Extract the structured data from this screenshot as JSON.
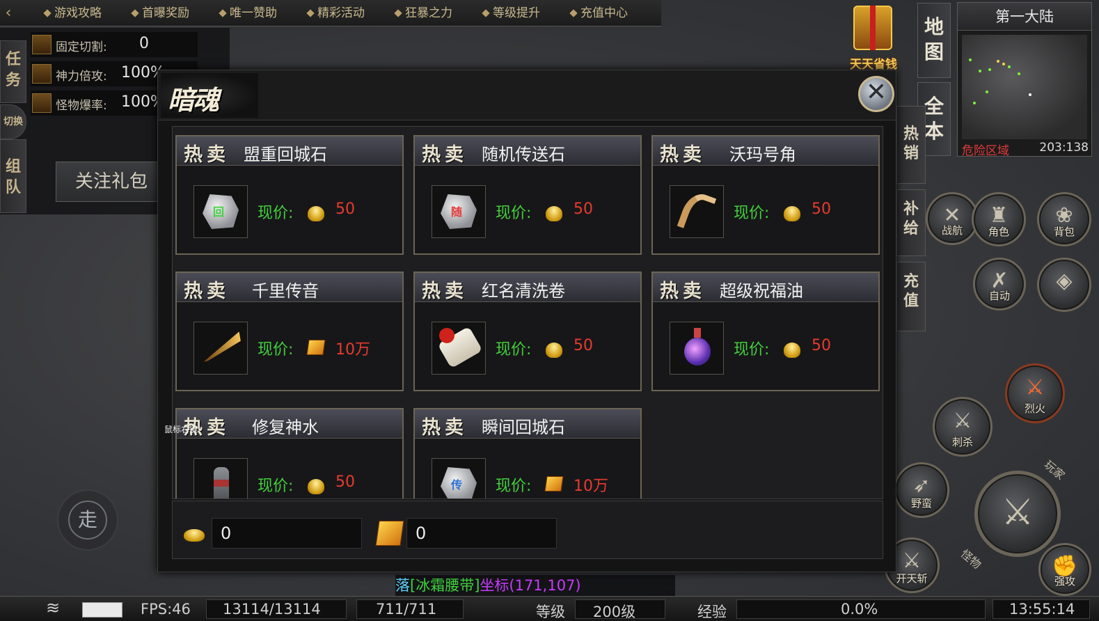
{
  "topnav": {
    "items": [
      "游戏攻略",
      "首曝奖励",
      "唯一赞助",
      "精彩活动",
      "狂暴之力",
      "等级提升",
      "充值中心"
    ]
  },
  "leftpanel": {
    "tabs": [
      "任务",
      "组队"
    ],
    "tab_partial": "切换",
    "buffs": [
      {
        "label": "固定切割:",
        "value": "0"
      },
      {
        "label": "神力倍攻:",
        "value": "100%"
      },
      {
        "label": "怪物爆率:",
        "value": "100%"
      }
    ],
    "follow_gift": "关注礼包"
  },
  "gift": {
    "label": "天天省钱"
  },
  "map": {
    "button": "地图",
    "full_button": "全本",
    "region": "第一大陆",
    "danger": "危险区域",
    "coords": "203:138"
  },
  "side_buttons": [
    "热销",
    "补给",
    "充值"
  ],
  "skills": {
    "row1": [
      "战航",
      "角色",
      "背包"
    ],
    "auto": "自动",
    "liehuo": "烈火",
    "cisha": "刺杀",
    "yeman": "野蛮",
    "kaitian": "开天斩",
    "qianggong": "强攻",
    "wanjia": "玩家",
    "guaiwu": "怪物"
  },
  "walk": "走",
  "tooltip": "鼠标右键",
  "shop": {
    "title": "暗魂",
    "hot_tag": "热卖",
    "price_label": "现价:",
    "items": [
      {
        "name": "盟重回城石",
        "currency": "gold",
        "amount": "50",
        "icon_text": "回"
      },
      {
        "name": "随机传送石",
        "currency": "gold",
        "amount": "50",
        "icon_text": "随"
      },
      {
        "name": "沃玛号角",
        "currency": "gold",
        "amount": "50",
        "icon_text": ""
      },
      {
        "name": "千里传音",
        "currency": "ticket",
        "amount": "10万",
        "icon_text": ""
      },
      {
        "name": "红名清洗卷",
        "currency": "gold",
        "amount": "50",
        "icon_text": ""
      },
      {
        "name": "超级祝福油",
        "currency": "gold",
        "amount": "50",
        "icon_text": ""
      },
      {
        "name": "修复神水",
        "currency": "gold",
        "amount": "50",
        "icon_text": ""
      },
      {
        "name": "瞬间回城石",
        "currency": "ticket",
        "amount": "10万",
        "icon_text": "传"
      }
    ],
    "balance_gold": "0",
    "balance_ticket": "0"
  },
  "chat": {
    "line1": "落",
    "item": "[冰霜腰带]",
    "coord": "坐标(171,107)"
  },
  "bottombar": {
    "fps": "FPS:46",
    "hp": "13114/13114",
    "mp": "711/711",
    "level_label": "等级",
    "level": "200级",
    "exp_label": "经验",
    "exp": "0.0%",
    "time": "13:55:14"
  }
}
